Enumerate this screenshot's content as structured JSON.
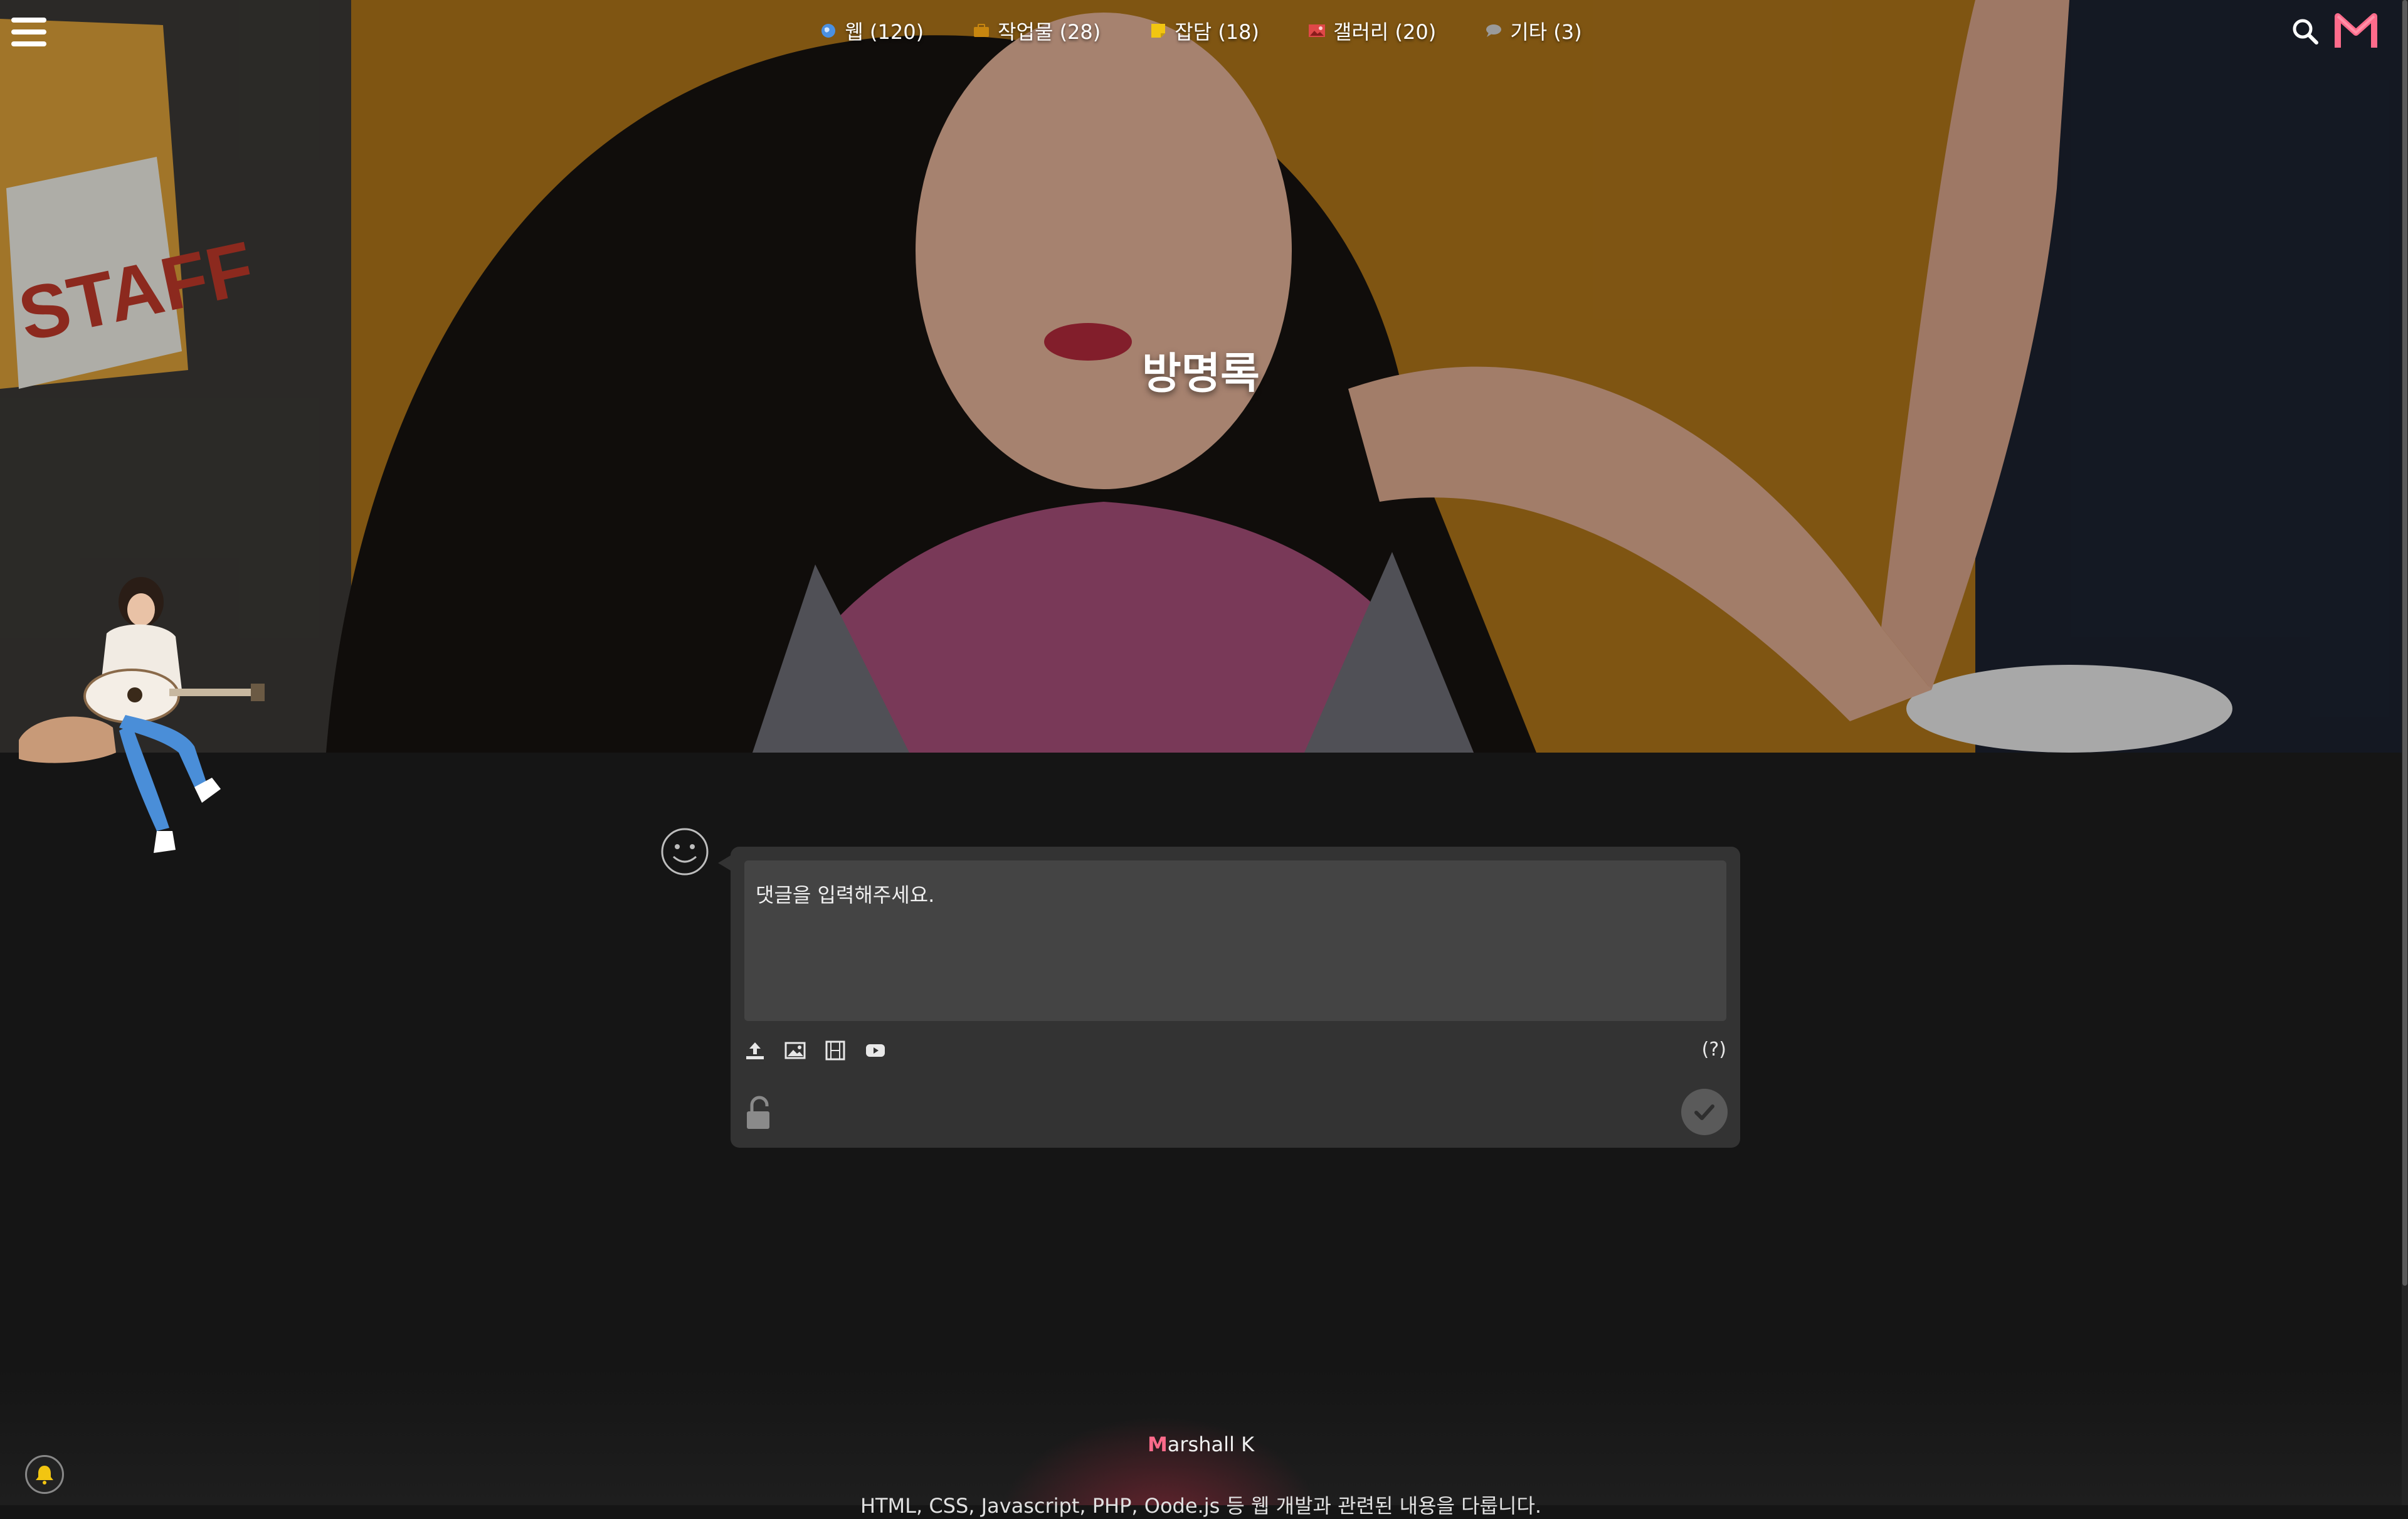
{
  "nav": {
    "items": [
      {
        "label": "웹 (120)",
        "icon": "globe-icon",
        "color": "#4a90e2"
      },
      {
        "label": "작업물 (28)",
        "icon": "briefcase-icon",
        "color": "#c8860f"
      },
      {
        "label": "잡담 (18)",
        "icon": "note-icon",
        "color": "#f2c511"
      },
      {
        "label": "갤러리 (20)",
        "icon": "picture-icon",
        "color": "#e04848"
      },
      {
        "label": "기타 (3)",
        "icon": "chat-bubble-icon",
        "color": "#9a9a9a"
      }
    ]
  },
  "hero": {
    "title": "방명록"
  },
  "comment": {
    "placeholder": "댓글을 입력해주세요.",
    "help_label": "(?)"
  },
  "footer": {
    "brand_mark": "M",
    "brand_text": "arshall K",
    "description": "HTML, CSS, Javascript, PHP, Oode.js 등 웹 개발과 관련된 내용을 다룹니다."
  },
  "colors": {
    "accent": "#ff6b8b",
    "background": "#151515",
    "box": "#333333"
  }
}
